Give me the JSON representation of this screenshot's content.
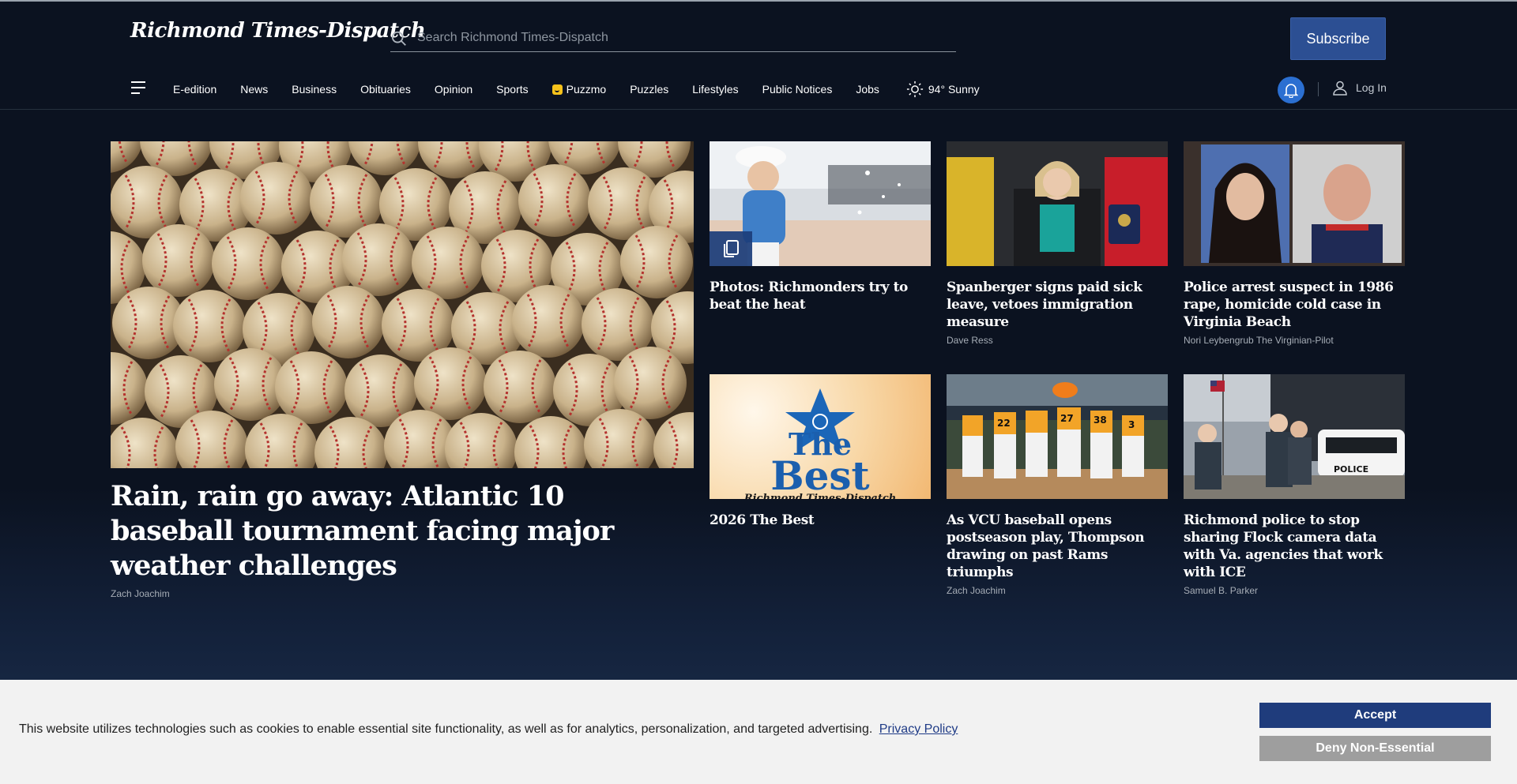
{
  "header": {
    "logo": "Richmond Times-Dispatch",
    "search_placeholder": "Search Richmond Times-Dispatch",
    "subscribe_label": "Subscribe"
  },
  "nav": {
    "items": [
      "E-edition",
      "News",
      "Business",
      "Obituaries",
      "Opinion",
      "Sports",
      "Puzzmo",
      "Puzzles",
      "Lifestyles",
      "Public Notices",
      "Jobs"
    ],
    "weather": "94° Sunny",
    "login_label": "Log In"
  },
  "feature": {
    "title": "Rain, rain go away: Atlantic 10 baseball tournament facing major weather challenges",
    "byline": "Zach Joachim"
  },
  "cards": [
    {
      "title": "Photos: Richmonders try to beat the heat",
      "byline": ""
    },
    {
      "title": "Spanberger signs paid sick leave, vetoes immigration measure",
      "byline": "Dave Ress"
    },
    {
      "title": "Police arrest suspect in 1986 rape, homicide cold case in Virginia Beach",
      "byline": "Nori Leybengrub The Virginian-Pilot"
    },
    {
      "title": "2026 The Best",
      "byline": ""
    },
    {
      "title": "As VCU baseball opens postseason play, Thompson drawing on past Rams triumphs",
      "byline": "Zach Joachim"
    },
    {
      "title": "Richmond police to stop sharing Flock camera data with Va. agencies that work with ICE",
      "byline": "Samuel B. Parker"
    }
  ],
  "promo": {
    "line1": "The",
    "line2": "Best",
    "masthead": "Richmond Times-Dispatch"
  },
  "cookie": {
    "text": "This website utilizes technologies such as cookies to enable essential site functionality, as well as for analytics, personalization, and targeted advertising.",
    "link": "Privacy Policy",
    "accept": "Accept",
    "deny": "Deny Non-Essential"
  },
  "colors": {
    "background": "#0b1220",
    "subscribe": "#2c4f93",
    "bell": "#2b6fd1",
    "accept": "#1f3c7c",
    "deny": "#9e9e9e"
  }
}
